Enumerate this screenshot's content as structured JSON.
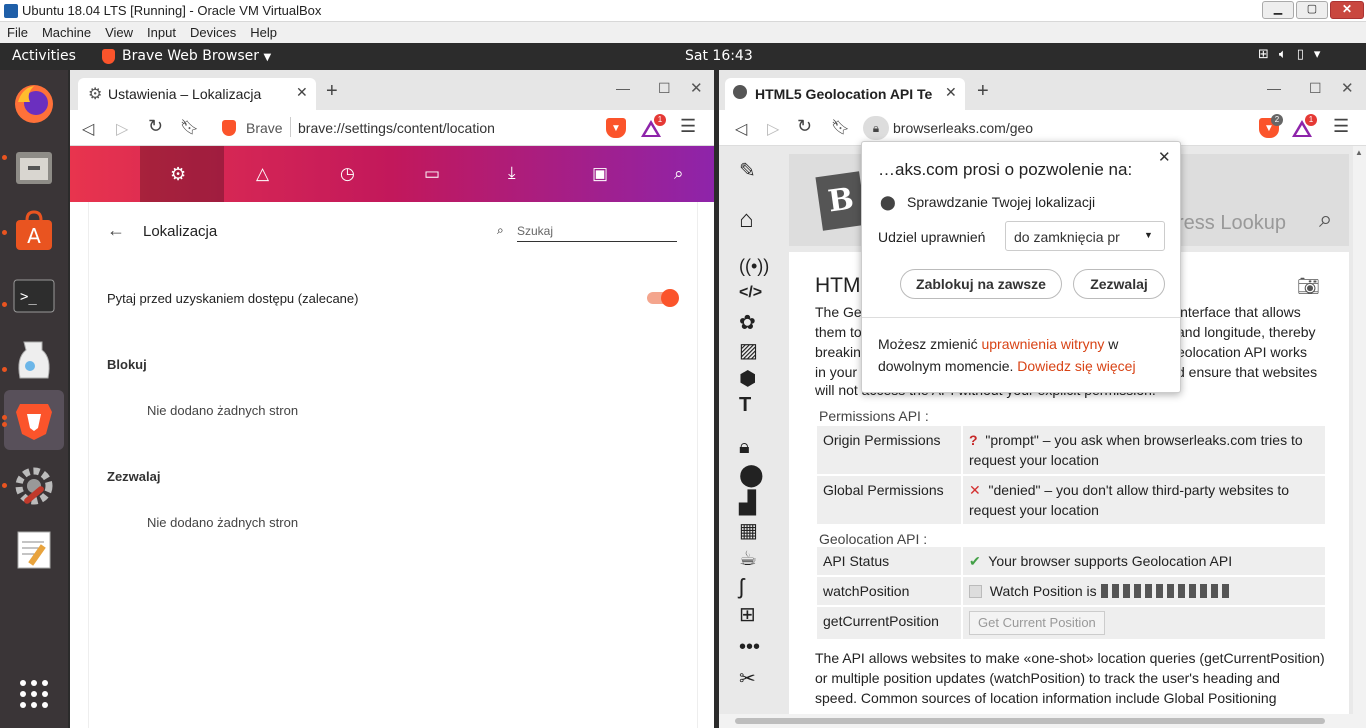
{
  "vbox": {
    "title": "Ubuntu 18.04 LTS [Running] - Oracle VM VirtualBox",
    "menu": [
      "File",
      "Machine",
      "View",
      "Input",
      "Devices",
      "Help"
    ]
  },
  "topbar": {
    "activities": "Activities",
    "app": "Brave Web Browser",
    "clock": "Sat 16:43"
  },
  "dock": [
    "firefox-icon",
    "files-icon",
    "software-icon",
    "terminal-icon",
    "libreoffice-icon",
    "brave-icon",
    "settings-icon",
    "text-editor-icon",
    "app-grid-icon"
  ],
  "left": {
    "tab_title": "Ustawienia – Lokalizacja",
    "url_label": "Brave",
    "url": "brave://settings/content/location",
    "rewards_badge": "1",
    "page_title": "Lokalizacja",
    "search_placeholder": "Szukaj",
    "ask_label": "Pytaj przed uzyskaniem dostępu (zalecane)",
    "ask_enabled": true,
    "block_heading": "Blokuj",
    "block_empty": "Nie dodano żadnych stron",
    "allow_heading": "Zezwalaj",
    "allow_empty": "Nie dodano żadnych stron",
    "accent_colors": [
      "#e8344e",
      "#c2185b",
      "#8e24aa"
    ]
  },
  "right": {
    "tab_title": "HTML5 Geolocation API Te",
    "url": "browserleaks.com/geo",
    "shields_badge": "2",
    "rewards_badge": "1",
    "lookup_placeholder": "ress Lookup",
    "heading": "HTM",
    "intro_left": [
      "The Ge",
      "them to",
      "breakin",
      "in your"
    ],
    "intro_right": [
      "interface that allows",
      "and longitude, thereby",
      "eolocation API works",
      "d ensure that websites"
    ],
    "intro_last": "will not access the API without your explicit permission.",
    "permissions_label": "Permissions API :",
    "perm_rows": [
      {
        "k": "Origin Permissions",
        "mark": "?",
        "v": "\"prompt\" – you ask when browserleaks.com tries to request your location"
      },
      {
        "k": "Global Permissions",
        "mark": "✕",
        "v": "\"denied\" – you don't allow third-party websites to request your location"
      }
    ],
    "geo_label": "Geolocation API :",
    "api_status_k": "API Status",
    "api_status_mark": "✔",
    "api_status_v": "Your browser supports Geolocation API",
    "watch_k": "watchPosition",
    "watch_v": "Watch Position is",
    "getpos_k": "getCurrentPosition",
    "getpos_btn": "Get Current Position",
    "para": [
      "The API allows websites to make «one-shot» location queries (getCurrentPosition)",
      "or multiple position updates (watchPosition) to track the user's heading and",
      "speed. Common sources of location information include Global Positioning"
    ]
  },
  "popup": {
    "title": "…aks.com prosi o pozwolenie na:",
    "item": "Sprawdzanie Twojej lokalizacji",
    "grant_label": "Udziel uprawnień",
    "grant_value": "do zamknięcia pr",
    "block_btn": "Zablokuj na zawsze",
    "allow_btn": "Zezwalaj",
    "footer_a": "Możesz zmienić ",
    "footer_link1": "uprawnienia witryny",
    "footer_b": " w",
    "footer_c": "dowolnym momencie. ",
    "footer_link2": "Dowiedz się więcej"
  }
}
